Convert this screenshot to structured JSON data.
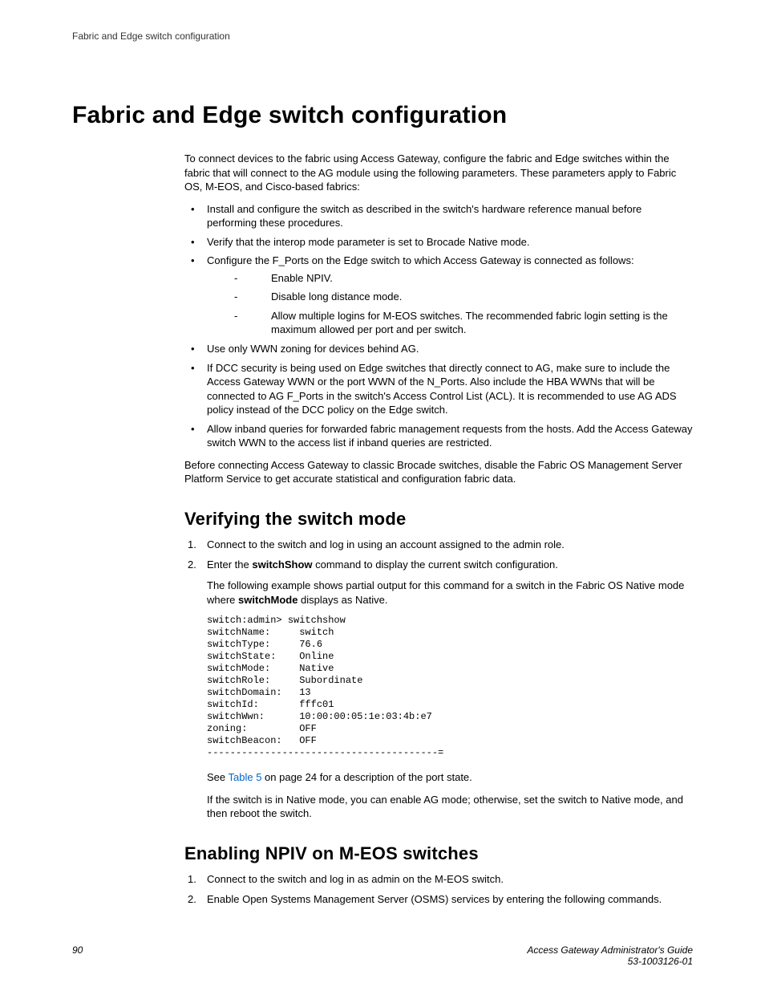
{
  "runningHeader": "Fabric and Edge switch configuration",
  "h1": "Fabric and Edge switch configuration",
  "intro": "To connect devices to the fabric using Access Gateway, configure the fabric and Edge switches within the fabric that will connect to the AG module using the following parameters. These parameters apply to Fabric OS, M-EOS, and Cisco-based fabrics:",
  "bullets": {
    "b1": "Install and configure the switch as described in the switch's hardware reference manual before performing these procedures.",
    "b2": "Verify that the interop mode parameter is set to Brocade Native mode.",
    "b3": "Configure the F_Ports on the Edge switch to which Access Gateway is connected as follows:",
    "b3sub": {
      "s1": "Enable NPIV.",
      "s2": "Disable long distance mode.",
      "s3": "Allow multiple logins for M-EOS switches. The recommended fabric login setting is the maximum allowed per port and per switch."
    },
    "b4": "Use only WWN zoning for devices behind AG.",
    "b5": "If DCC security is being used on Edge switches that directly connect to AG, make sure to include the Access Gateway WWN or the port WWN of the N_Ports. Also include the HBA WWNs that will be connected to AG F_Ports in the switch's Access Control List (ACL). It is recommended to use AG ADS policy instead of the DCC policy on the Edge switch.",
    "b6": "Allow inband queries for forwarded fabric management requests from the hosts. Add the Access Gateway switch WWN to the access list if inband queries are restricted."
  },
  "afterBullets": "Before connecting Access Gateway to classic Brocade switches, disable the Fabric OS Management Server Platform Service to get accurate statistical and configuration fabric data.",
  "sec1": {
    "title": "Verifying the switch mode",
    "step1": "Connect to the switch and log in using an account assigned to the admin role.",
    "step2a": "Enter the ",
    "step2bold": "switchShow",
    "step2b": " command to display the current switch configuration.",
    "step2p1a": "The following example shows partial output for this command for a switch in the Fabric OS Native mode where ",
    "step2p1bold": "switchMode",
    "step2p1b": " displays as Native.",
    "code": "switch:admin> switchshow\nswitchName:     switch\nswitchType:     76.6\nswitchState:    Online\nswitchMode:     Native\nswitchRole:     Subordinate\nswitchDomain:   13\nswitchId:       fffc01\nswitchWwn:      10:00:00:05:1e:03:4b:e7\nzoning:         OFF\nswitchBeacon:   OFF\n----------------------------------------=",
    "afterCodeA": "See ",
    "afterCodeLink": "Table 5",
    "afterCodeB": " on page 24 for a description of the port state.",
    "afterCode2": "If the switch is in Native mode, you can enable AG mode; otherwise, set the switch to Native mode, and then reboot the switch."
  },
  "sec2": {
    "title": "Enabling NPIV on M-EOS switches",
    "step1": "Connect to the switch and log in as admin on the M-EOS switch.",
    "step2": "Enable Open Systems Management Server (OSMS) services by entering the following commands."
  },
  "footer": {
    "page": "90",
    "title": "Access Gateway Administrator's Guide",
    "docnum": "53-1003126-01"
  }
}
